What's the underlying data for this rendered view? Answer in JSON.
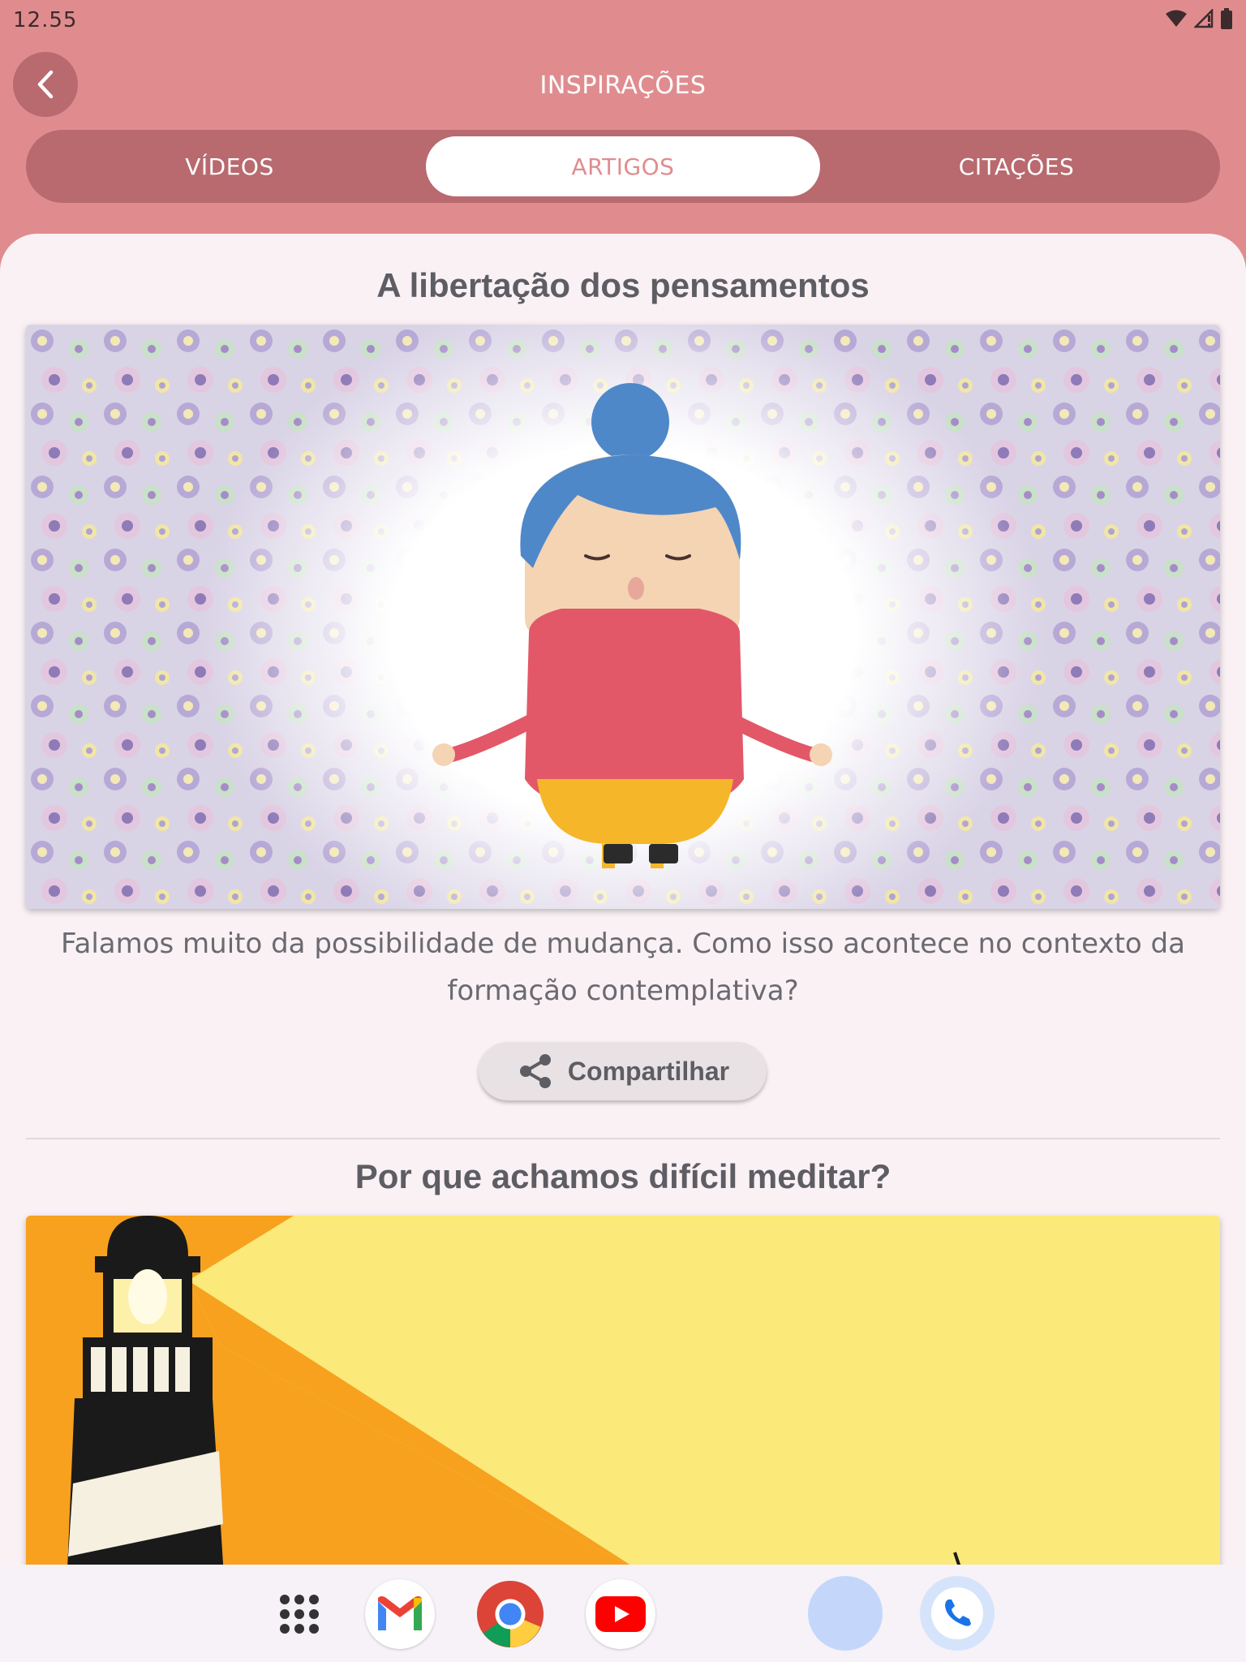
{
  "status": {
    "time": "12.55"
  },
  "header": {
    "title": "INSPIRAÇÕES"
  },
  "tabs": [
    {
      "label": "VÍDEOS",
      "active": false
    },
    {
      "label": "ARTIGOS",
      "active": true
    },
    {
      "label": "CITAÇÕES",
      "active": false
    }
  ],
  "articles": [
    {
      "title": "A libertação dos pensamentos",
      "summary": "Falamos muito da possibilidade de mudança. Como isso acontece no contexto da formação contemplativa?",
      "share_label": "Compartilhar"
    },
    {
      "title": "Por que achamos difícil meditar?"
    }
  ],
  "dock": {
    "apps": [
      "app-drawer-icon",
      "gmail-icon",
      "chrome-icon",
      "youtube-icon",
      "blank-app-icon",
      "phone-icon"
    ]
  },
  "colors": {
    "header_bg": "#e08c8f",
    "tab_track": "#b86a6f",
    "content_bg": "#faf1f5",
    "accent_text": "#e08c8f"
  }
}
